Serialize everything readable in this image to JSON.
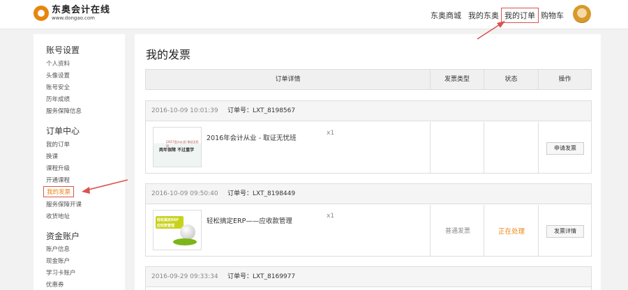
{
  "header": {
    "logo_cn": "东奥会计在线",
    "logo_en": "www.dongao.com",
    "nav": [
      "东奥商城",
      "我的东奥",
      "我的订单",
      "购物车"
    ]
  },
  "sidebar": {
    "sections": [
      {
        "title": "账号设置",
        "items": [
          "个人资料",
          "头像设置",
          "账号安全",
          "历年成绩",
          "服务保障信息"
        ]
      },
      {
        "title": "订单中心",
        "items": [
          "我的订单",
          "换课",
          "课程升级",
          "开通课程",
          "我的发票",
          "服务保障开课",
          "收货地址"
        ]
      },
      {
        "title": "资金账户",
        "items": [
          "账户信息",
          "现金账户",
          "学习卡账户",
          "优惠券"
        ]
      }
    ],
    "current": "我的发票"
  },
  "main": {
    "title": "我的发票",
    "columns": [
      "订单详情",
      "发票类型",
      "状态",
      "操作"
    ],
    "orders": [
      {
        "date": "2016-10-09 10:01:39",
        "order_no": "订单号：LXT_8198567",
        "product": "2016年会计从业 - 取证无忧班",
        "qty": "x1",
        "thumb_small": "[2017会计从业] 取证无忧班",
        "thumb_main": "两年保障 不过重学",
        "invoice_type": "",
        "status": "",
        "action": "申请发票"
      },
      {
        "date": "2016-10-09 09:50:40",
        "order_no": "订单号：LXT_8198449",
        "product": "轻松搞定ERP——应收款管理",
        "qty": "x1",
        "thumb_banner_1": "轻松搞定ERP",
        "thumb_banner_2": "应收款管理",
        "invoice_type": "普通发票",
        "status": "正在处理",
        "action": "发票详情"
      },
      {
        "date": "2016-09-29 09:33:34",
        "order_no": "订单号：LXT_8169977"
      }
    ]
  },
  "colors": {
    "accent": "#e8850f",
    "annotation": "#d9534f"
  }
}
